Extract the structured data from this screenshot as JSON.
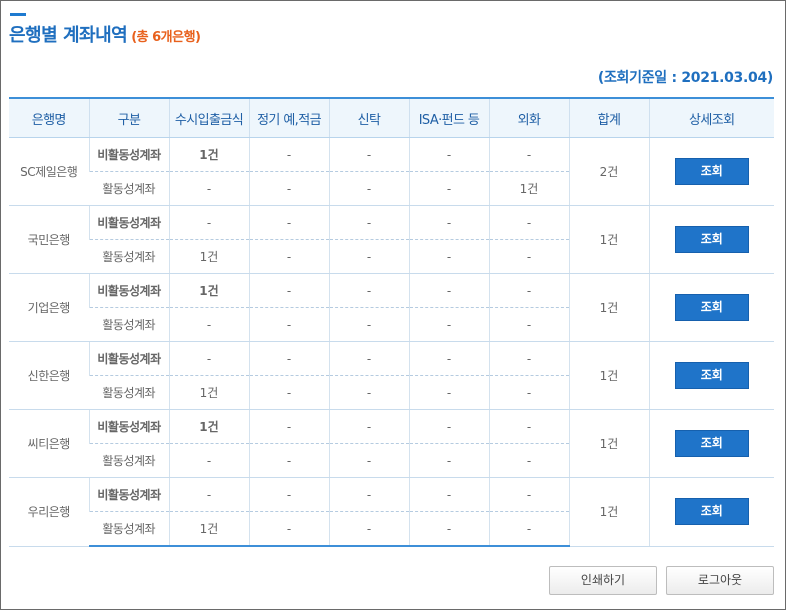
{
  "title": "은행별 계좌내역",
  "title_sub": "(총 6개은행)",
  "basis_label": "(조회기준일 : 2021.03.04)",
  "columns": [
    "은행명",
    "구분",
    "수시입출금식",
    "정기 예,적금",
    "신탁",
    "ISA·펀드 등",
    "외화",
    "합계",
    "상세조회"
  ],
  "category_inactive": "비활동성계좌",
  "category_active": "활동성계좌",
  "view_label": "조회",
  "banks": [
    {
      "name": "SC제일은행",
      "inactive": [
        "1건",
        "-",
        "-",
        "-",
        "-"
      ],
      "active": [
        "-",
        "-",
        "-",
        "-",
        "1건"
      ],
      "total": "2건"
    },
    {
      "name": "국민은행",
      "inactive": [
        "-",
        "-",
        "-",
        "-",
        "-"
      ],
      "active": [
        "1건",
        "-",
        "-",
        "-",
        "-"
      ],
      "total": "1건"
    },
    {
      "name": "기업은행",
      "inactive": [
        "1건",
        "-",
        "-",
        "-",
        "-"
      ],
      "active": [
        "-",
        "-",
        "-",
        "-",
        "-"
      ],
      "total": "1건"
    },
    {
      "name": "신한은행",
      "inactive": [
        "-",
        "-",
        "-",
        "-",
        "-"
      ],
      "active": [
        "1건",
        "-",
        "-",
        "-",
        "-"
      ],
      "total": "1건"
    },
    {
      "name": "씨티은행",
      "inactive": [
        "1건",
        "-",
        "-",
        "-",
        "-"
      ],
      "active": [
        "-",
        "-",
        "-",
        "-",
        "-"
      ],
      "total": "1건"
    },
    {
      "name": "우리은행",
      "inactive": [
        "-",
        "-",
        "-",
        "-",
        "-"
      ],
      "active": [
        "1건",
        "-",
        "-",
        "-",
        "-"
      ],
      "total": "1건"
    }
  ],
  "buttons": {
    "print": "인쇄하기",
    "logout": "로그아웃"
  },
  "colors": {
    "accent": "#1f6fbf",
    "button": "#1f74c9",
    "sub_title": "#e8601c"
  }
}
